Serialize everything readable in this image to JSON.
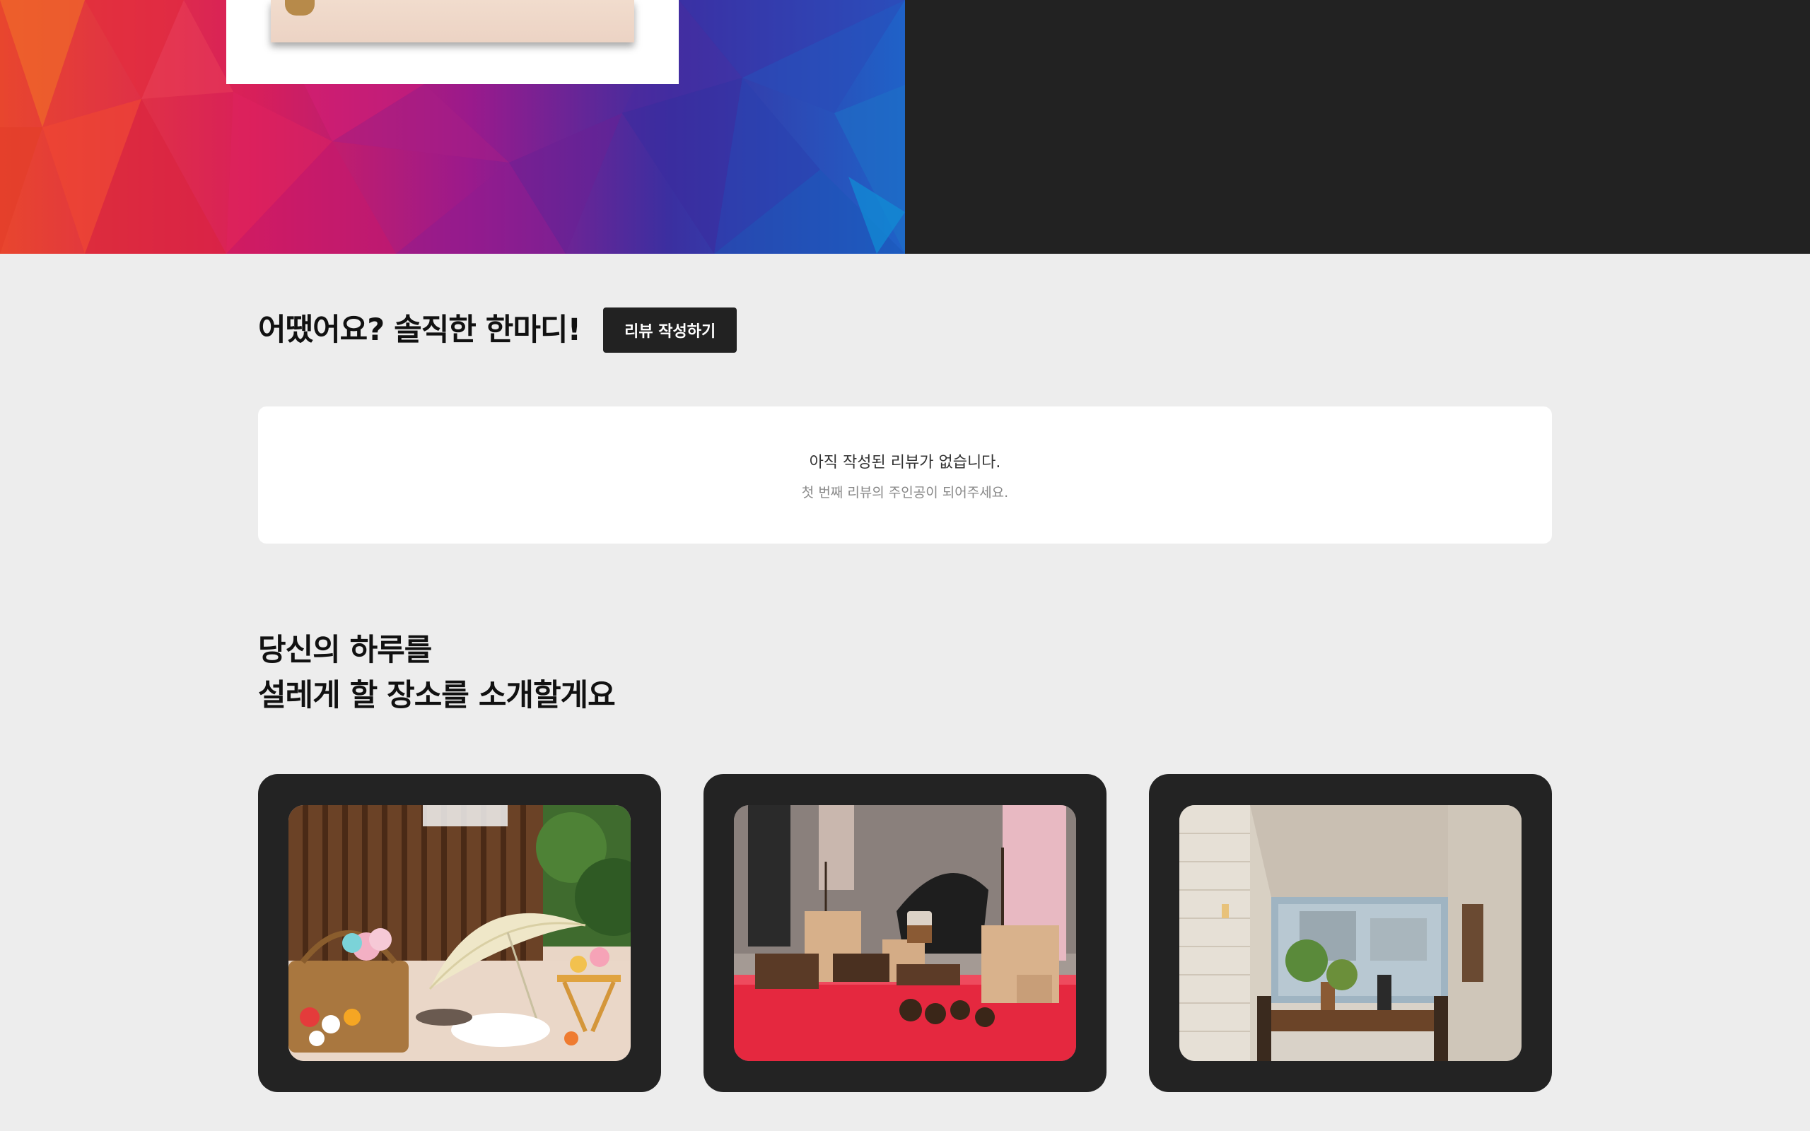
{
  "colors": {
    "page_bg": "#ededed",
    "dark_panel": "#222222",
    "card_bg": "#232323",
    "button_bg": "#222222"
  },
  "review": {
    "title": "어땠어요? 솔직한 한마디!",
    "write_button": "리뷰 작성하기",
    "empty_main": "아직 작성된 리뷰가 없습니다.",
    "empty_sub": "첫 번째 리뷰의 주인공이 되어주세요."
  },
  "places": {
    "title_line1": "당신의 하루를",
    "title_line2": "설레게 할 장소를 소개할게요",
    "cards": [
      {
        "icon": "flower-picnic-photo"
      },
      {
        "icon": "craft-market-photo"
      },
      {
        "icon": "cafe-interior-photo"
      }
    ]
  }
}
